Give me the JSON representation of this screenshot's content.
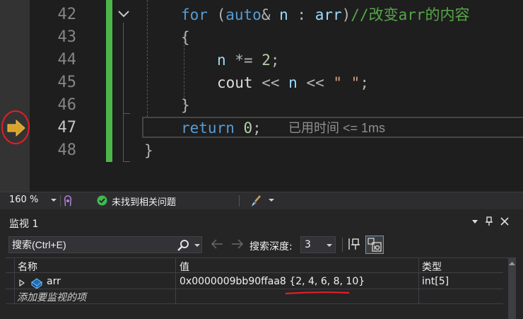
{
  "editor": {
    "line_numbers": [
      "42",
      "43",
      "44",
      "45",
      "46",
      "47",
      "48"
    ],
    "lines": {
      "l42": {
        "kw_for": "for",
        "paren_open": " (",
        "kw_auto": "auto",
        "amp": "& ",
        "var_n": "n",
        "colon": " : ",
        "var_arr": "arr",
        "paren_close": ")",
        "comment": "//改变arr的内容"
      },
      "l43": "{",
      "l44": {
        "var_n": "n",
        "op": " *= ",
        "num": "2",
        "semi": ";"
      },
      "l45": {
        "cout": "cout",
        "op1": " << ",
        "var_n": "n",
        "op2": " << ",
        "str": "\" \"",
        "semi": ";"
      },
      "l46": "}",
      "l47": {
        "kw_return": "return",
        "num": " 0",
        "semi": ";"
      },
      "l48": "}"
    },
    "perf_tip": "已用时间 <= 1ms",
    "colors": {
      "change_bar": "#4db649",
      "breakpoint_arrow": "#d9a32b",
      "annotation_circle": "#e41e26"
    }
  },
  "statusbar": {
    "zoom": "160 %",
    "issues": "未找到相关问题",
    "icons": [
      "chevron-down-icon",
      "intellicode-icon",
      "check-circle-icon",
      "brush-icon"
    ]
  },
  "watch": {
    "title": "监视 1",
    "search_placeholder": "搜索(Ctrl+E)",
    "depth_label": "搜索深度:",
    "depth_value": "3",
    "columns": {
      "name": "名称",
      "value": "值",
      "type": "类型"
    },
    "rows": [
      {
        "name": "arr",
        "value_addr": "0x0000009bb90ffaa8",
        "value_content": "{2, 4, 6, 8, 10}",
        "type": "int[5]"
      }
    ],
    "add_item": "添加要监视的项",
    "icons": [
      "pin-icon",
      "close-icon",
      "search-icon",
      "back-arrow-icon",
      "forward-arrow-icon",
      "hex-display-icon"
    ]
  }
}
